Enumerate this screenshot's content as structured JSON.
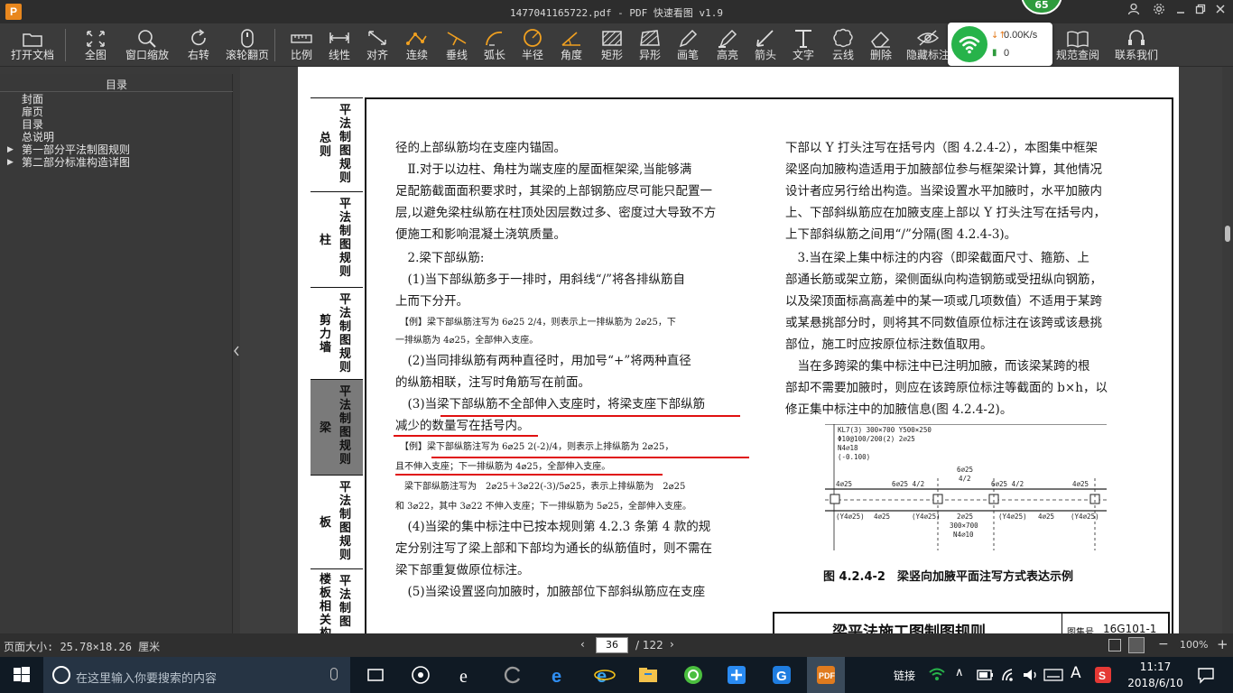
{
  "window": {
    "logo": "P",
    "title": "1477041165722.pdf - PDF 快速看图 v1.9",
    "badge": "65"
  },
  "toolbar": {
    "items": [
      {
        "label": "打开文档",
        "icon": "folder-icon"
      },
      {
        "label": "全图",
        "icon": "fit-page-icon"
      },
      {
        "label": "窗口缩放",
        "icon": "zoom-icon"
      },
      {
        "label": "右转",
        "icon": "rotate-icon"
      },
      {
        "label": "滚轮翻页",
        "icon": "mouse-icon"
      },
      {
        "label": "比例",
        "icon": "scale-icon"
      },
      {
        "label": "线性",
        "icon": "linear-icon"
      },
      {
        "label": "对齐",
        "icon": "align-icon"
      },
      {
        "label": "连续",
        "icon": "continuous-icon"
      },
      {
        "label": "垂线",
        "icon": "perpendicular-icon"
      },
      {
        "label": "弧长",
        "icon": "arc-length-icon"
      },
      {
        "label": "半径",
        "icon": "radius-icon"
      },
      {
        "label": "角度",
        "icon": "angle-icon"
      },
      {
        "label": "矩形",
        "icon": "rectangle-icon"
      },
      {
        "label": "异形",
        "icon": "polygon-icon"
      },
      {
        "label": "画笔",
        "icon": "pen-icon"
      },
      {
        "label": "高亮",
        "icon": "highlight-icon"
      },
      {
        "label": "箭头",
        "icon": "arrow-icon"
      },
      {
        "label": "文字",
        "icon": "text-icon"
      },
      {
        "label": "云线",
        "icon": "cloud-icon"
      },
      {
        "label": "删除",
        "icon": "eraser-icon"
      },
      {
        "label": "隐藏标注",
        "icon": "hide-icon"
      },
      {
        "label": "规范查阅",
        "icon": "book-icon"
      },
      {
        "label": "联系我们",
        "icon": "contact-icon"
      }
    ]
  },
  "network": {
    "speed": "0.00K/s",
    "count": "0"
  },
  "sidebar": {
    "title": "目录",
    "items": [
      {
        "label": "封面",
        "expandable": false
      },
      {
        "label": "扉页",
        "expandable": false
      },
      {
        "label": "目录",
        "expandable": false
      },
      {
        "label": "总说明",
        "expandable": false
      },
      {
        "label": "第一部分平法制图规则",
        "expandable": true
      },
      {
        "label": "第二部分标准构造详图",
        "expandable": true
      }
    ]
  },
  "document": {
    "tabs": [
      {
        "left": "总则",
        "right": "平法制图规则"
      },
      {
        "left": "柱",
        "right": "平法制图规则"
      },
      {
        "left": "剪力墙",
        "right": "平法制图规则"
      },
      {
        "left": "梁",
        "right": "平法制图规则",
        "active": true
      },
      {
        "left": "板",
        "right": "平法制图规则"
      },
      {
        "left": "楼板相关构造",
        "right": "平法制图"
      }
    ],
    "left_col": [
      "径的上部纵筋均在支座内锚固。",
      "　Ⅱ.对于以边柱、角柱为端支座的屋面框架梁,当能够满",
      "足配筋截面面积要求时，其梁的上部钢筋应尽可能只配置一",
      "层,以避免梁柱纵筋在柱顶处因层数过多、密度过大导致不方",
      "便施工和影响混凝土浇筑质量。",
      "　2.梁下部纵筋:",
      "　(1)当下部纵筋多于一排时，用斜线“/”将各排纵筋自",
      "上而下分开。",
      "　【例】梁下部纵筋注写为 6⌀25 2/4，则表示上一排纵筋为 2⌀25，下",
      "一排纵筋为 4⌀25，全部伸入支座。",
      "　(2)当同排纵筋有两种直径时，用加号“+”将两种直径",
      "的纵筋相联，注写时角筋写在前面。",
      "　(3)当梁下部纵筋不全部伸入支座时，将梁支座下部纵筋",
      "减少的数量写在括号内。",
      "　【例】梁下部纵筋注写为 6⌀25 2(-2)/4，则表示上排纵筋为 2⌀25，",
      "且不伸入支座；下一排纵筋为 4⌀25，全部伸入支座。",
      "　梁下部纵筋注写为　2⌀25＋3⌀22(-3)/5⌀25，表示上排纵筋为　2⌀25",
      "和 3⌀22，其中 3⌀22 不伸入支座；下一排纵筋为 5⌀25，全部伸入支座。",
      "　(4)当梁的集中标注中已按本规则第 4.2.3 条第 4 款的规",
      "定分别注写了梁上部和下部均为通长的纵筋值时，则不需在",
      "梁下部重复做原位标注。",
      "　(5)当梁设置竖向加腋时，加腋部位下部斜纵筋应在支座"
    ],
    "right_col": [
      "下部以 Y 打头注写在括号内（图 4.2.4-2），本图集中框架",
      "梁竖向加腋构造适用于加腋部位参与框架梁计算，其他情况",
      "设计者应另行给出构造。当梁设置水平加腋时，水平加腋内",
      "上、下部斜纵筋应在加腋支座上部以 Y 打头注写在括号内，",
      "上下部斜纵筋之间用“/”分隔(图 4.2.4-3)。",
      "　3.当在梁上集中标注的内容（即梁截面尺寸、箍筋、上",
      "部通长筋或架立筋，梁侧面纵向构造钢筋或受扭纵向钢筋，",
      "以及梁顶面标高高差中的某一项或几项数值）不适用于某跨",
      "或某悬挑部分时，则将其不同数值原位标注在该跨或该悬挑",
      "部位，施工时应按原位标注数值取用。",
      "　当在多跨梁的集中标注中已注明加腋，而该梁某跨的根",
      "部却不需要加腋时，则应在该跨原位标注等截面的 b×h，以",
      "修正集中标注中的加腋信息(图 4.2.4-2)。"
    ],
    "figure": {
      "labels": [
        "KL7(3) 300×700 Y500×250",
        "Φ10@100/200(2) 2⌀25",
        "N4⌀18",
        "(-0.100)",
        "4⌀25",
        "6⌀25 4/2",
        "6⌀25",
        "4/2",
        "6⌀25 4/2",
        "4⌀25",
        "(Y4⌀25)",
        "4⌀25",
        "(Y4⌀25)",
        "2⌀25",
        "(Y4⌀25)",
        "4⌀25",
        "(Y4⌀25)",
        "300×700",
        "N4⌀10"
      ],
      "caption": "图 4.2.4-2　梁竖向加腋平面注写方式表达示例"
    },
    "footer_title": "梁平法施工图制图规则",
    "footer_label": "图集号",
    "footer_code": "16G101-1"
  },
  "status": {
    "page_size": "页面大小: 25.78×18.26 厘米",
    "current_page": "36",
    "total_pages": "/ 122",
    "zoom": "100%"
  },
  "taskbar": {
    "search_placeholder": "在这里输入你要搜索的内容",
    "tray_link": "链接",
    "time": "11:17",
    "date": "2018/6/10"
  }
}
